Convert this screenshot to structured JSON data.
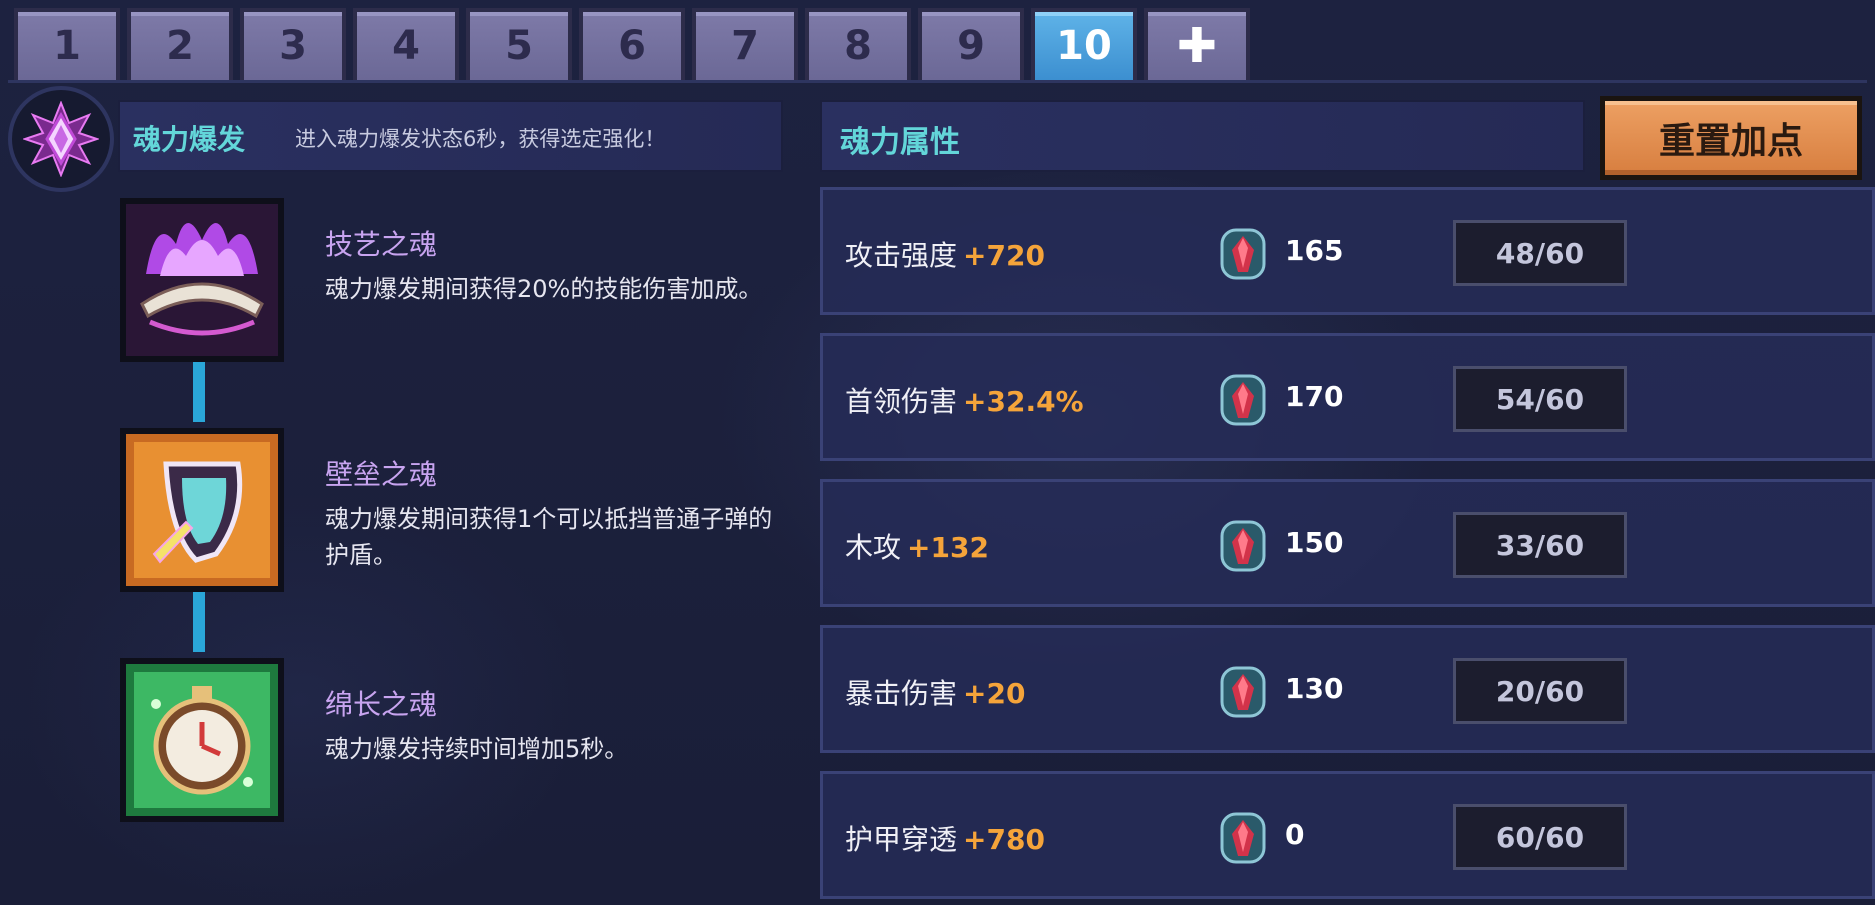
{
  "tabs": [
    {
      "label": "1",
      "active": false
    },
    {
      "label": "2",
      "active": false
    },
    {
      "label": "3",
      "active": false
    },
    {
      "label": "4",
      "active": false
    },
    {
      "label": "5",
      "active": false
    },
    {
      "label": "6",
      "active": false
    },
    {
      "label": "7",
      "active": false
    },
    {
      "label": "8",
      "active": false
    },
    {
      "label": "9",
      "active": false
    },
    {
      "label": "10",
      "active": true
    },
    {
      "label": "✚",
      "active": false
    }
  ],
  "burst": {
    "title": "魂力爆发",
    "description": "进入魂力爆发状态6秒，获得选定强化！"
  },
  "souls": [
    {
      "name": "技艺之魂",
      "description": "魂力爆发期间获得20%的技能伤害加成。",
      "icon": "purple-flame-book-icon"
    },
    {
      "name": "壁垒之魂",
      "description": "魂力爆发期间获得1个可以抵挡普通子弹的护盾。",
      "icon": "shield-icon"
    },
    {
      "name": "绵长之魂",
      "description": "魂力爆发持续时间增加5秒。",
      "icon": "clock-icon"
    }
  ],
  "attributes": {
    "title": "魂力属性",
    "reset_label": "重置加点",
    "rows": [
      {
        "name": "攻击强度",
        "bonus": "+720",
        "cost": "165",
        "points": "48/60"
      },
      {
        "name": "首领伤害",
        "bonus": "+32.4%",
        "cost": "170",
        "points": "54/60"
      },
      {
        "name": "木攻",
        "bonus": "+132",
        "cost": "150",
        "points": "33/60"
      },
      {
        "name": "暴击伤害",
        "bonus": "+20",
        "cost": "130",
        "points": "20/60"
      },
      {
        "name": "护甲穿透",
        "bonus": "+780",
        "cost": "0",
        "points": "60/60"
      }
    ]
  },
  "colors": {
    "accent_cyan": "#63d6d9",
    "bonus_orange": "#f5a43a",
    "soul_name_purple": "#c8a4f0",
    "reset_orange": "#e39150",
    "active_tab_blue": "#4ea3de"
  }
}
